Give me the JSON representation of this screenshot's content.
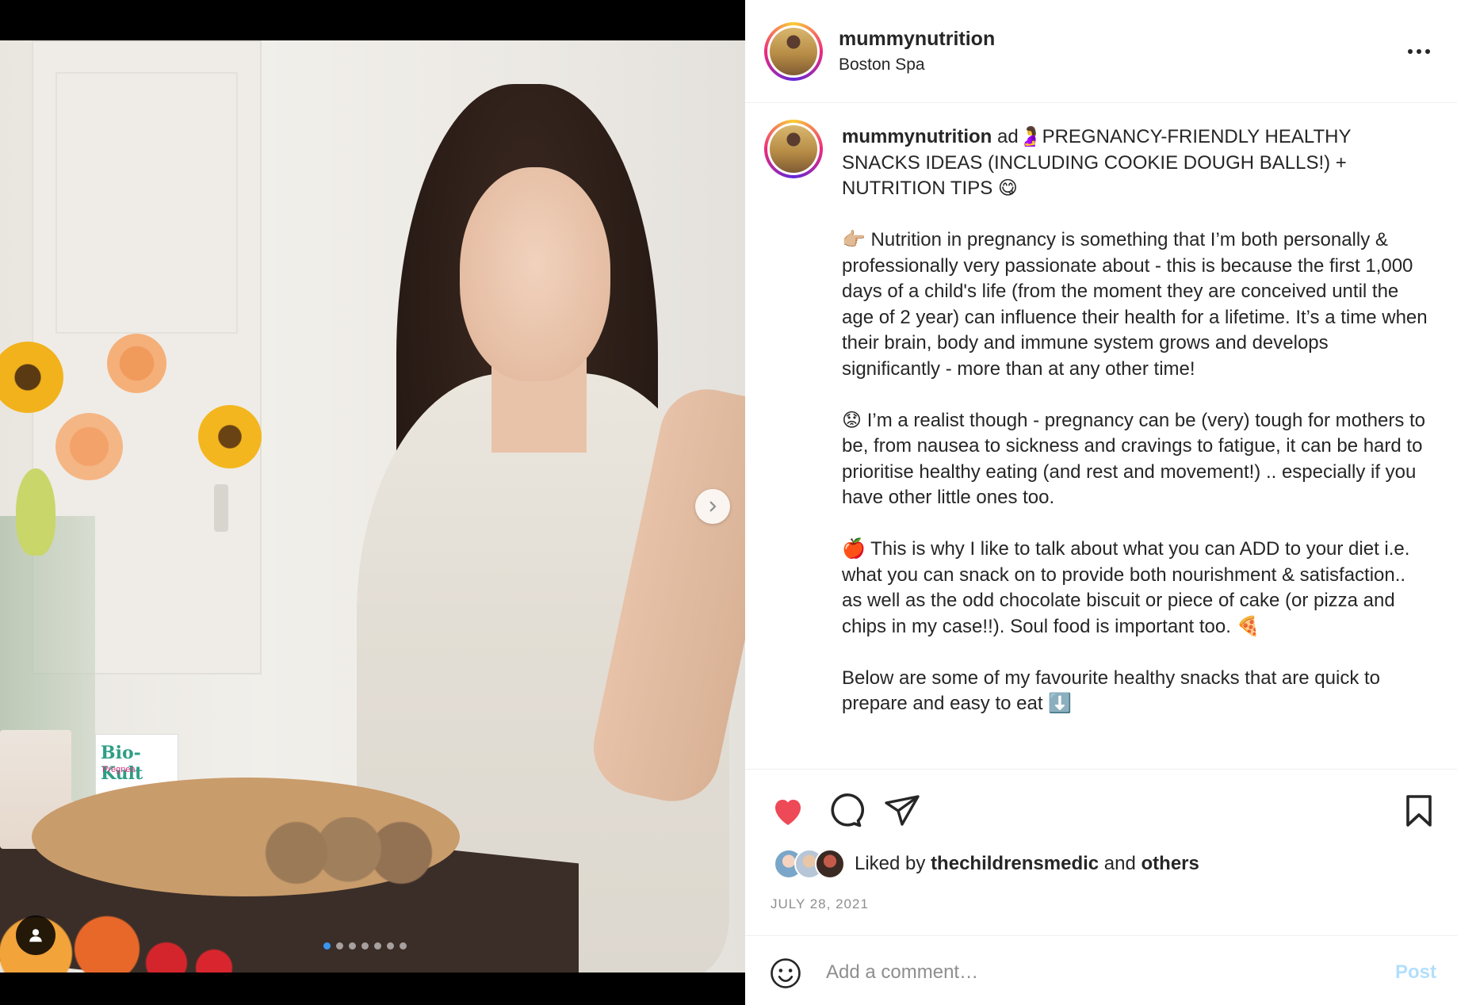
{
  "post": {
    "username": "mummynutrition",
    "location": "Boston Spa",
    "carousel": {
      "slide_count": 7,
      "active_slide": 1
    },
    "product_box": {
      "brand": "Bio-Kult",
      "sub": "Pregnea"
    },
    "caption": {
      "author": "mummynutrition",
      "headline": "ad🤰PREGNANCY-FRIENDLY HEALTHY SNACKS IDEAS (INCLUDING COOKIE DOUGH BALLS!) + NUTRITION TIPS 😋",
      "paragraphs": [
        "👉🏼 Nutrition in pregnancy is something that I’m both personally & professionally very passionate about - this is because the first 1,000 days of a child's life (from the moment they are conceived until the age of 2 year) can influence their health for a lifetime. It’s a time when their brain, body and immune system grows and develops significantly - more than at any other time!",
        "😟 I’m a realist though - pregnancy can be (very) tough for mothers to be, from nausea to sickness and cravings to fatigue, it can be hard to prioritise healthy eating (and rest and movement!) .. especially if you have other little ones too.",
        "🍎 This is why I like to talk about what you can ADD to your diet i.e. what you can snack on to provide both nourishment & satisfaction.. as well as the odd chocolate biscuit or piece of cake (or pizza and chips in my case!!). Soul food is important too. 🍕",
        "Below are some of my favourite healthy snacks that are quick to prepare and easy to eat ⬇️"
      ]
    },
    "likes": {
      "prefix": "Liked by",
      "user": "thechildrensmedic",
      "joiner": "and",
      "others": "others"
    },
    "date": "JULY 28, 2021",
    "comment": {
      "placeholder": "Add a comment…",
      "post_label": "Post"
    },
    "colors": {
      "like_red": "#ed4956",
      "post_blue": "#b2dffc",
      "dot_active": "#3897f0"
    }
  }
}
